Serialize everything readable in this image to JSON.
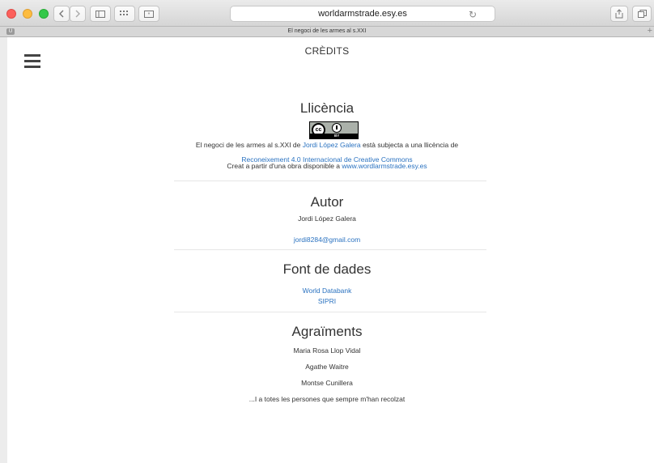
{
  "browser": {
    "address": "worldarmstrade.esy.es",
    "tab_title": "El negoci de les armes al s.XXI",
    "tab_favicon": "U"
  },
  "page": {
    "title": "CRÈDITS",
    "license": {
      "heading": "Llicència",
      "badge_text": "BY",
      "line1_pre": "El negoci de les armes al s.XXI de ",
      "line1_author": "Jordi López Galera",
      "line1_post": " està subjecta a una llicència de",
      "line2_link": "Reconeixement 4.0 Internacional de Creative Commons",
      "line3_pre": "Creat a partir d'una obra disponible a ",
      "line3_link": "www.wordlarmstrade.esy.es"
    },
    "author": {
      "heading": "Autor",
      "name": "Jordi López Galera",
      "email": "jordi8284@gmail.com"
    },
    "sources": {
      "heading": "Font de dades",
      "items": [
        "World Databank",
        "SIPRI"
      ]
    },
    "thanks": {
      "heading": "Agraïments",
      "people": [
        "Maria Rosa Llop Vidal",
        "Agathe Waitre",
        "Montse Cunillera"
      ],
      "closing": "...I a totes les persones que sempre m'han recolzat"
    }
  }
}
